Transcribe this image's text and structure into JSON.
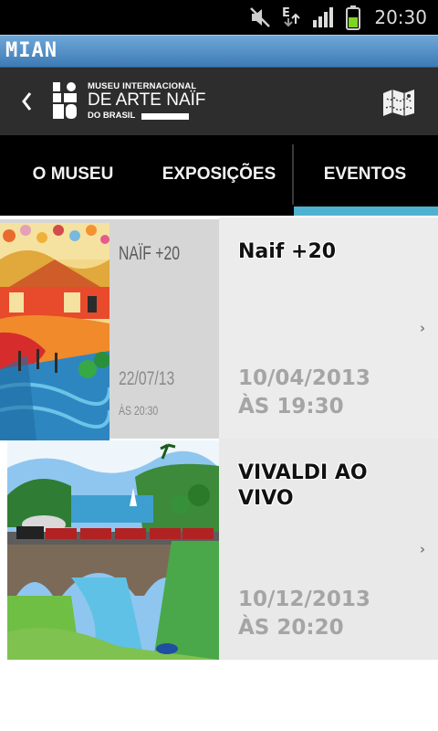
{
  "status_bar": {
    "time": "20:30",
    "network_label": "E",
    "icons": [
      "mute-icon",
      "data-arrows-icon",
      "signal-icon",
      "battery-icon"
    ]
  },
  "app": {
    "title": "MIAN"
  },
  "header": {
    "back_icon": "chevron-left-icon",
    "logo": {
      "line1": "MUSEU INTERNACIONAL",
      "line2": "DE ARTE NAÏF",
      "line3": "DO BRASIL"
    },
    "map_icon": "map-icon"
  },
  "tabs": [
    {
      "label": "O MUSEU",
      "selected": false
    },
    {
      "label": "EXPOSIÇÕES",
      "selected": false
    },
    {
      "label": "EVENTOS",
      "selected": true
    }
  ],
  "colors": {
    "accent": "#4fb1d1",
    "appbar": "#4f8cc6",
    "header": "#2d2d2d"
  },
  "events": [
    {
      "title": "Naif +20",
      "date": "10/04/2013",
      "time": "ÀS 19:30",
      "poster_title": "NAÏF +20",
      "poster_date": "22/07/13",
      "poster_time": "ÀS 20:30"
    },
    {
      "title": "VIVALDI AO VIVO",
      "date": "10/12/2013",
      "time": "ÀS 20:20"
    }
  ]
}
